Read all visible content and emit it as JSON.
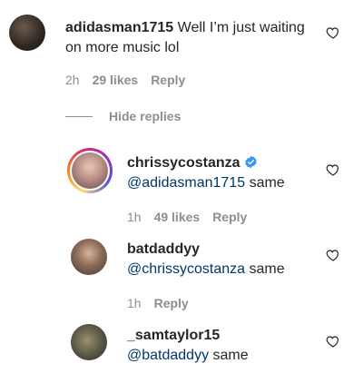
{
  "comments": [
    {
      "username": "adidasman1715",
      "text": "Well I’m just waiting on more music lol",
      "time": "2h",
      "likes": "29 likes",
      "reply": "Reply"
    }
  ],
  "hide_replies": "Hide replies",
  "replies": [
    {
      "username": "chrissycostanza",
      "verified": true,
      "mention": "@adidasman1715",
      "text": "same",
      "time": "1h",
      "likes": "49 likes",
      "reply": "Reply"
    },
    {
      "username": "batdaddyy",
      "mention": "@chrissycostanza",
      "text": "same",
      "time": "1h",
      "reply": "Reply"
    },
    {
      "username": "_samtaylor15",
      "mention": "@batdaddyy",
      "text": "same"
    }
  ],
  "colors": {
    "text": "#262626",
    "muted": "#8e8e8e",
    "mention": "#00376b",
    "verified": "#3897f0"
  },
  "icons": [
    "heart-icon",
    "verified-badge-icon"
  ]
}
